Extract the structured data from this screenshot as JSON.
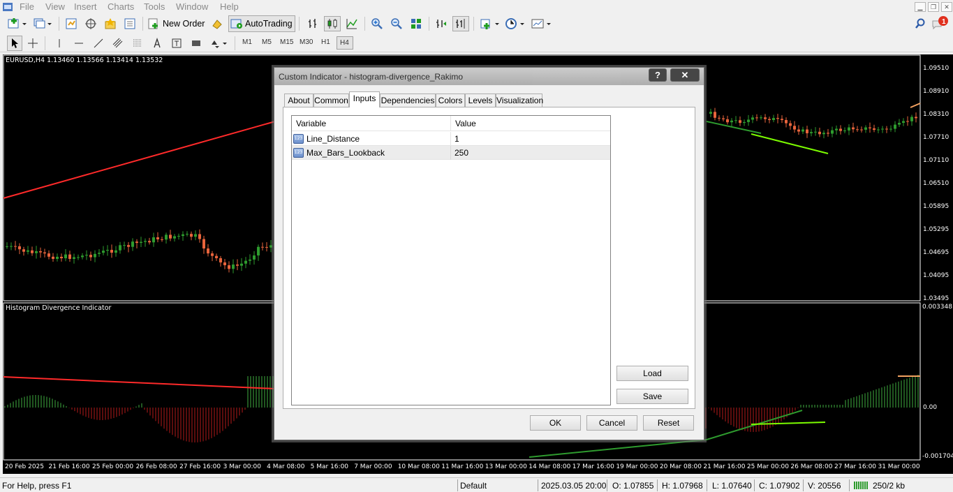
{
  "menu": {
    "items": [
      "File",
      "View",
      "Insert",
      "Charts",
      "Tools",
      "Window",
      "Help"
    ]
  },
  "toolbar": {
    "new_order_label": "New Order",
    "autotrading_label": "AutoTrading",
    "timeframes": [
      "M1",
      "M5",
      "M15",
      "M30",
      "H1",
      "H4"
    ],
    "active_timeframe": "H4",
    "notification_count": "1"
  },
  "chart": {
    "header": "EURUSD,H4  1.13460 1.13566 1.13414 1.13532",
    "indicator_title": "Histogram Divergence Indicator",
    "price_scale": [
      "1.09510",
      "1.08910",
      "1.08310",
      "1.07710",
      "1.07110",
      "1.06510",
      "1.05895",
      "1.05295",
      "1.04695",
      "1.04095",
      "1.03495"
    ],
    "indicator_scale": [
      "0.003348",
      "0.00",
      "-0.001704"
    ],
    "time_labels": [
      "20 Feb 2025",
      "21 Feb 16:00",
      "25 Feb 00:00",
      "26 Feb 08:00",
      "27 Feb 16:00",
      "3 Mar 00:00",
      "4 Mar 08:00",
      "5 Mar 16:00",
      "7 Mar 00:00",
      "10 Mar 08:00",
      "11 Mar 16:00",
      "13 Mar 00:00",
      "14 Mar 08:00",
      "17 Mar 16:00",
      "19 Mar 00:00",
      "20 Mar 08:00",
      "21 Mar 16:00",
      "25 Mar 00:00",
      "26 Mar 08:00",
      "27 Mar 16:00",
      "31 Mar 00:00"
    ],
    "colors": {
      "bull": "#2e9b2e",
      "bear": "#e8643c",
      "divergence_red": "#ff2a2a",
      "divergence_green": "#7cfc00",
      "background": "#000000"
    }
  },
  "dialog": {
    "title": "Custom Indicator - histogram-divergence_Rakimo",
    "help_label": "?",
    "close_label": "✕",
    "tabs": [
      "About",
      "Common",
      "Inputs",
      "Dependencies",
      "Colors",
      "Levels",
      "Visualization"
    ],
    "active_tab": "Inputs",
    "grid_headers": {
      "variable": "Variable",
      "value": "Value"
    },
    "params": [
      {
        "name": "Line_Distance",
        "value": "1",
        "icon": "123"
      },
      {
        "name": "Max_Bars_Lookback",
        "value": "250",
        "icon": "123"
      }
    ],
    "load_label": "Load",
    "save_label": "Save",
    "ok_label": "OK",
    "cancel_label": "Cancel",
    "reset_label": "Reset"
  },
  "status": {
    "help": "For Help, press F1",
    "profile": "Default",
    "datetime": "2025.03.05 20:00",
    "open": "O: 1.07855",
    "high": "H: 1.07968",
    "low": "L: 1.07640",
    "close": "C: 1.07902",
    "volume": "V: 20556",
    "traffic": "250/2 kb"
  }
}
